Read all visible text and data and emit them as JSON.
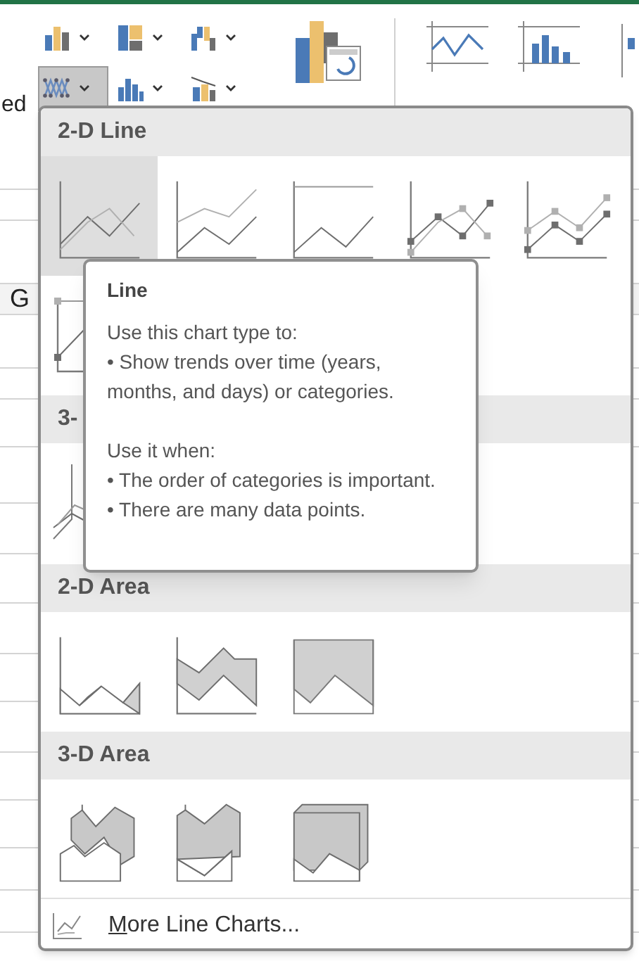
{
  "ribbon": {
    "cut_label": "ed",
    "small_buttons": [
      {
        "kind": "column",
        "selected": false
      },
      {
        "kind": "hierarchy",
        "selected": false
      },
      {
        "kind": "waterfall",
        "selected": false
      },
      {
        "kind": "line",
        "selected": true
      },
      {
        "kind": "statistic",
        "selected": false
      },
      {
        "kind": "combo",
        "selected": false
      }
    ],
    "gallery": [
      {
        "kind": "pivot"
      },
      {
        "kind": "line"
      },
      {
        "kind": "column"
      },
      {
        "kind": "cut"
      }
    ]
  },
  "sheet": {
    "column_header": "G"
  },
  "menu": {
    "sections": [
      {
        "title": "2-D Line",
        "items": [
          {
            "kind": "line",
            "selected": true
          },
          {
            "kind": "stacked-line",
            "selected": false
          },
          {
            "kind": "percent-line",
            "selected": false
          },
          {
            "kind": "line-markers",
            "selected": false
          },
          {
            "kind": "stacked-markers",
            "selected": false
          },
          {
            "kind": "percent-markers",
            "selected": false
          }
        ]
      },
      {
        "title": "3-",
        "items": [
          {
            "kind": "line-3d",
            "selected": false
          }
        ]
      },
      {
        "title": "2-D Area",
        "items": [
          {
            "kind": "area",
            "selected": false
          },
          {
            "kind": "stacked-area",
            "selected": false
          },
          {
            "kind": "percent-area",
            "selected": false
          }
        ]
      },
      {
        "title": "3-D Area",
        "items": [
          {
            "kind": "area-3d",
            "selected": false
          },
          {
            "kind": "stacked-area-3d",
            "selected": false
          },
          {
            "kind": "percent-area-3d",
            "selected": false
          }
        ]
      }
    ],
    "more": {
      "label": "More Line Charts..."
    }
  },
  "tooltip": {
    "title": "Line",
    "paragraphs": [
      [
        "Use this chart type to:",
        "• Show trends over time (years, months, and days) or categories."
      ],
      [
        "Use it when:",
        "• The order of categories is important.",
        "• There are many data points."
      ]
    ]
  }
}
